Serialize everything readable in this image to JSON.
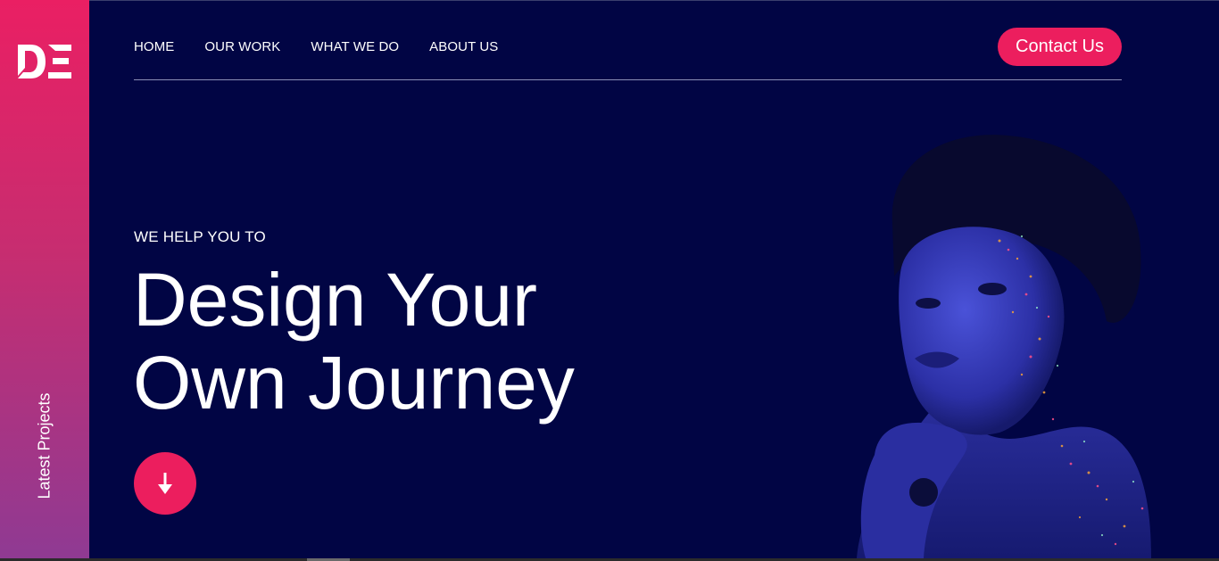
{
  "brand": {
    "logo_text": "DE"
  },
  "sidebar": {
    "label": "Latest Projects"
  },
  "nav": {
    "items": [
      {
        "label": "HOME"
      },
      {
        "label": "OUR WORK"
      },
      {
        "label": "WHAT WE DO"
      },
      {
        "label": "ABOUT US"
      }
    ],
    "contact_label": "Contact Us"
  },
  "hero": {
    "kicker": "WE HELP YOU TO",
    "title_line1": "Design Your",
    "title_line2": "Own Journey",
    "scroll_icon": "arrow-down-icon"
  },
  "colors": {
    "background": "#010544",
    "accent": "#ec1e5e",
    "sidebar_gradient_top": "#ea1f63",
    "sidebar_gradient_bottom": "#8f3a93"
  }
}
